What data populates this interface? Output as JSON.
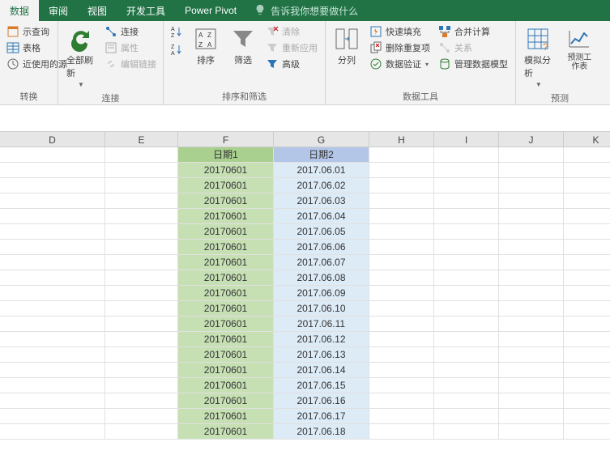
{
  "tabs": {
    "data": "数据",
    "review": "审阅",
    "view": "视图",
    "dev": "开发工具",
    "pivot": "Power Pivot"
  },
  "tell_me": "告诉我你想要做什么",
  "ribbon": {
    "queries": {
      "show_query": "示查询",
      "from_table": "表格",
      "recent": "近使用的源",
      "transform": "转换"
    },
    "connections": {
      "refresh_all": "全部刷新",
      "conn": "连接",
      "props": "属性",
      "edit_links": "编辑链接",
      "label": "连接"
    },
    "sort_filter": {
      "sort": "排序",
      "filter": "筛选",
      "clear": "清除",
      "reapply": "重新应用",
      "advanced": "高级",
      "label": "排序和筛选"
    },
    "data_tools": {
      "text_to_cols": "分列",
      "flash_fill": "快速填充",
      "remove_dup": "删除重复项",
      "validation": "数据验证",
      "consolidate": "合并计算",
      "relationships": "关系",
      "manage_model": "管理数据模型",
      "label": "数据工具"
    },
    "forecast": {
      "whatif": "模拟分析",
      "sheet": "预测工作表",
      "label": "预测"
    }
  },
  "columns": [
    "D",
    "E",
    "F",
    "G",
    "H",
    "I",
    "J",
    "K"
  ],
  "sheet": {
    "headerF": "日期1",
    "headerG": "日期2",
    "rows": [
      {
        "f": "20170601",
        "g": "2017.06.01"
      },
      {
        "f": "20170601",
        "g": "2017.06.02"
      },
      {
        "f": "20170601",
        "g": "2017.06.03"
      },
      {
        "f": "20170601",
        "g": "2017.06.04"
      },
      {
        "f": "20170601",
        "g": "2017.06.05"
      },
      {
        "f": "20170601",
        "g": "2017.06.06"
      },
      {
        "f": "20170601",
        "g": "2017.06.07"
      },
      {
        "f": "20170601",
        "g": "2017.06.08"
      },
      {
        "f": "20170601",
        "g": "2017.06.09"
      },
      {
        "f": "20170601",
        "g": "2017.06.10"
      },
      {
        "f": "20170601",
        "g": "2017.06.11"
      },
      {
        "f": "20170601",
        "g": "2017.06.12"
      },
      {
        "f": "20170601",
        "g": "2017.06.13"
      },
      {
        "f": "20170601",
        "g": "2017.06.14"
      },
      {
        "f": "20170601",
        "g": "2017.06.15"
      },
      {
        "f": "20170601",
        "g": "2017.06.16"
      },
      {
        "f": "20170601",
        "g": "2017.06.17"
      },
      {
        "f": "20170601",
        "g": "2017.06.18"
      }
    ]
  }
}
